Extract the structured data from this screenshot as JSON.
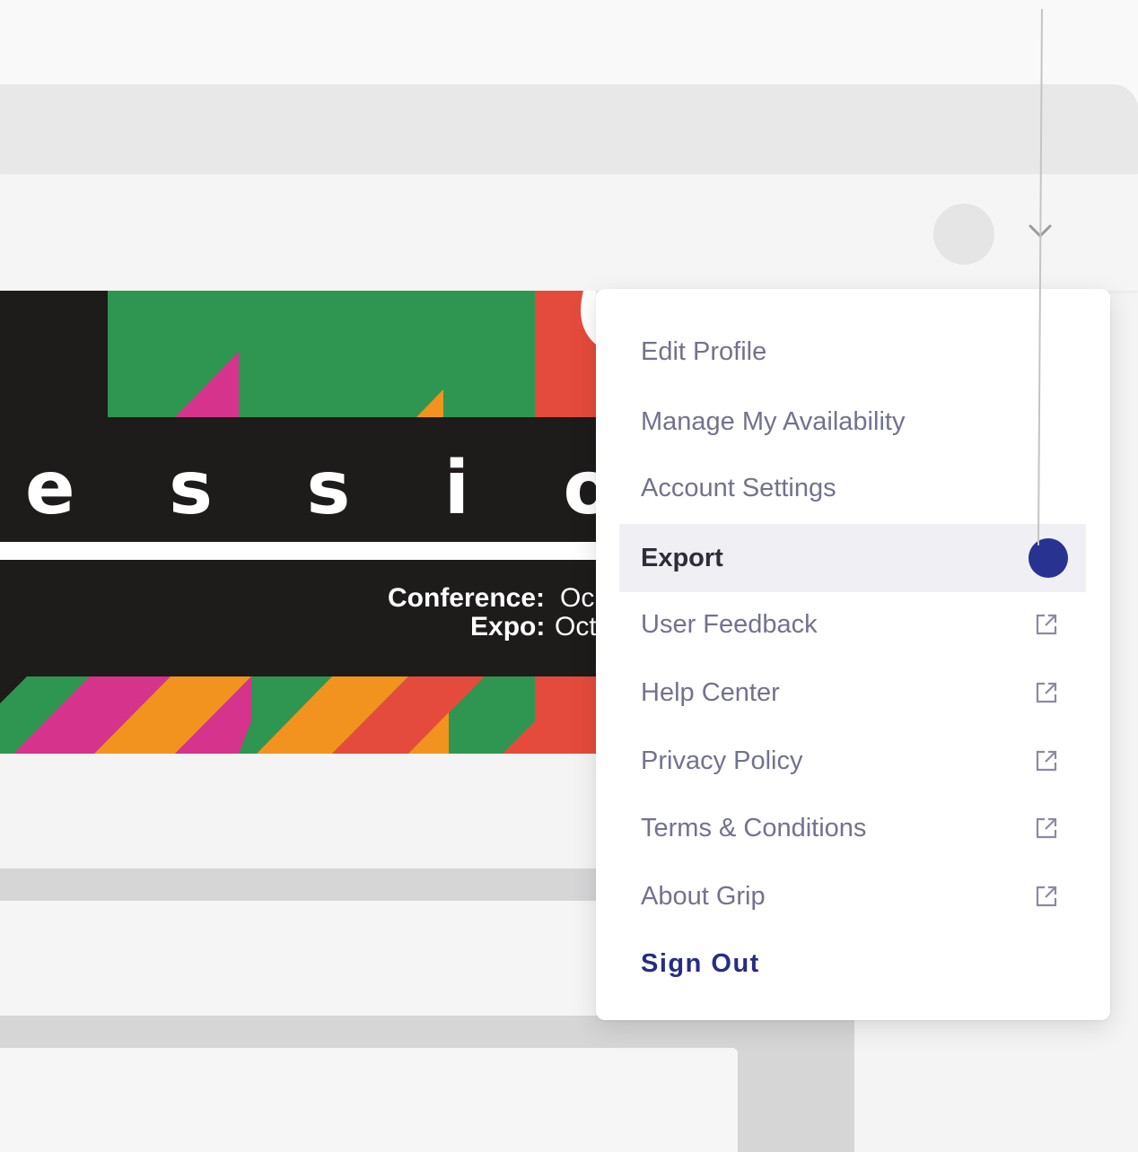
{
  "banner": {
    "title_text": "e s s i o n s   e",
    "conference_label": "Conference:",
    "conference_value": "Oc",
    "expo_label": "Expo:",
    "expo_value": "Oct"
  },
  "header": {
    "avatar": "user-avatar",
    "dropdown_icon": "chevron-down-icon"
  },
  "menu": {
    "items": [
      {
        "label": "Edit Profile",
        "external": false
      },
      {
        "label": "Manage My Availability",
        "external": false
      },
      {
        "label": "Account Settings",
        "external": false
      },
      {
        "label": "Export",
        "external": false,
        "active": true
      },
      {
        "label": "User Feedback",
        "external": true,
        "icon": "external-link-icon"
      },
      {
        "label": "Help Center",
        "external": true,
        "icon": "external-link-icon"
      },
      {
        "label": "Privacy Policy",
        "external": true,
        "icon": "external-link-icon"
      },
      {
        "label": "Terms & Conditions",
        "external": true,
        "icon": "external-link-icon"
      },
      {
        "label": "About Grip",
        "external": true,
        "icon": "external-link-icon"
      }
    ],
    "sign_out": "Sign Out"
  },
  "colors": {
    "accent": "#283291",
    "menu_text": "#72728f",
    "active_bg": "#efeff4",
    "green": "#2e9650",
    "magenta": "#d6338c",
    "orange": "#f2931f",
    "red": "#e54b3c"
  }
}
